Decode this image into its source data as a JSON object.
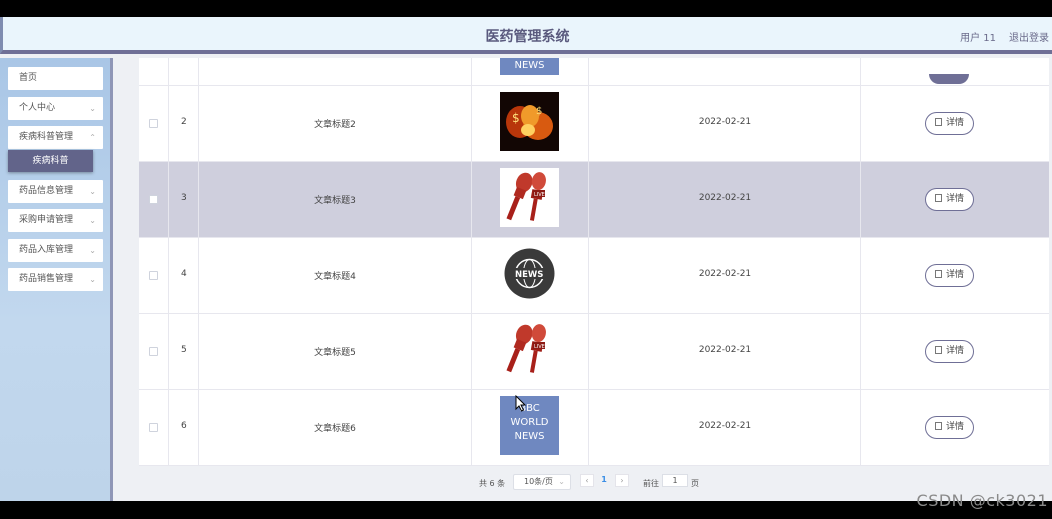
{
  "header": {
    "title": "医药管理系统",
    "user": "用户 11",
    "logout": "退出登录"
  },
  "sidebar": {
    "items": [
      {
        "label": "首页",
        "chev": ""
      },
      {
        "label": "个人中心",
        "chev": "⌄"
      },
      {
        "label": "疾病科普管理",
        "chev": "⌄"
      },
      {
        "label": "药品信息管理",
        "chev": "⌄"
      },
      {
        "label": "采购申请管理",
        "chev": "⌄"
      },
      {
        "label": "药品入库管理",
        "chev": "⌄"
      },
      {
        "label": "药品销售管理",
        "chev": "⌄"
      }
    ],
    "active_sub": "疾病科普"
  },
  "table": {
    "partial_image_text": "NEWS",
    "rows": [
      {
        "num": "2",
        "title": "文章标题2",
        "image": "fire-image",
        "date": "2022-02-21",
        "action": "详情",
        "selected": false
      },
      {
        "num": "3",
        "title": "文章标题3",
        "image": "microphones-image",
        "date": "2022-02-21",
        "action": "详情",
        "selected": true
      },
      {
        "num": "4",
        "title": "文章标题4",
        "image": "news-globe-image",
        "date": "2022-02-21",
        "action": "详情",
        "selected": false
      },
      {
        "num": "5",
        "title": "文章标题5",
        "image": "microphones-image",
        "date": "2022-02-21",
        "action": "详情",
        "selected": false
      },
      {
        "num": "6",
        "title": "文章标题6",
        "image": "bbc-world-news-image",
        "image_text": [
          "BBC",
          "WORLD",
          "NEWS"
        ],
        "date": "2022-02-21",
        "action": "详情",
        "selected": false
      }
    ]
  },
  "pagination": {
    "total": "共 6 条",
    "page_size": "10条/页",
    "prev": "‹",
    "current": "1",
    "next": "›",
    "goto_label": "前往",
    "goto_value": "1",
    "page_label": "页"
  },
  "watermark": "CSDN @ck3021",
  "colors": {
    "accent": "#6f6f96",
    "selected_row": "#cfcfdd",
    "sidebar": "#b7cfea",
    "header": "#eaf5fc"
  }
}
